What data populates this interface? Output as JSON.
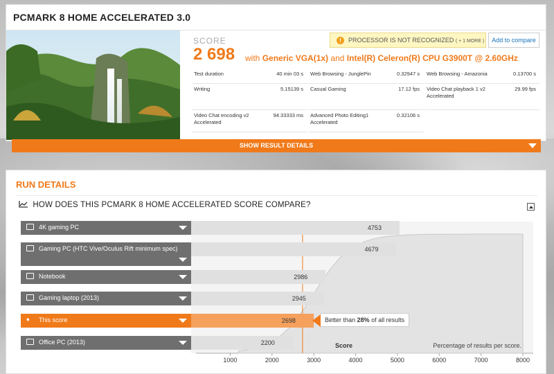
{
  "header": {
    "title": "PCMARK 8 HOME ACCELERATED 3.0"
  },
  "score": {
    "label": "SCORE",
    "value": "2 698",
    "with_text": "with",
    "gpu": "Generic VGA(1x)",
    "and_text": "and",
    "cpu": "Intel(R) Celeron(R) CPU G3900T @ 2.60GHz"
  },
  "warning": {
    "text": "PROCESSOR IS NOT RECOGNIZED",
    "more": "( + 1 MORE )"
  },
  "compare_button": "Add to compare",
  "stats": [
    {
      "name": "Test duration",
      "value": "40 min 03 s"
    },
    {
      "name": "Web Browsing - JunglePin",
      "value": "0.32947 s"
    },
    {
      "name": "Web Browsing - Amazonia",
      "value": "0.13700 s"
    },
    {
      "name": "Writing",
      "value": "5.15139 s"
    },
    {
      "name": "Casual Gaming",
      "value": "17.12 fps"
    },
    {
      "name": "Video Chat playback 1 v2 Accelerated",
      "value": "29.99 fps"
    },
    {
      "name": "Video Chat encoding v2 Accelerated",
      "value": "94.33333 ms"
    },
    {
      "name": "Advanced Photo Editing1 Accelerated",
      "value": "0.32106 s"
    }
  ],
  "show_details": "SHOW RESULT DETAILS",
  "run_details": {
    "title": "RUN DETAILS",
    "compare_title": "HOW DOES THIS PCMARK 8 HOME ACCELERATED SCORE COMPARE?"
  },
  "chart_data": {
    "type": "bar",
    "categories": [
      "4K gaming PC",
      "Gaming PC (HTC Vive/Oculus Rift minimum spec)",
      "Notebook",
      "Gaming laptop (2013)",
      "This score",
      "Office PC (2013)"
    ],
    "values": [
      4753,
      4679,
      2986,
      2945,
      2698,
      2200
    ],
    "highlight": "This score",
    "xlabel": "Score",
    "ylabel": "Percentage of results per score.",
    "xticks": [
      1000,
      2000,
      3000,
      4000,
      5000,
      6000,
      7000,
      8000
    ],
    "tooltip": {
      "prefix": "Better than",
      "percent": "28%",
      "suffix": "of all results"
    },
    "colors": {
      "accent": "#f07a1a",
      "bar": "#e0e0e0",
      "label": "#6f6f6f"
    }
  }
}
